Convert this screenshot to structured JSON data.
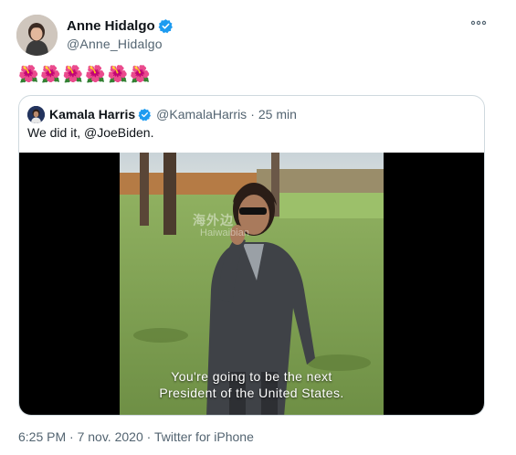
{
  "tweet": {
    "author_name": "Anne Hidalgo",
    "author_handle": "@Anne_Hidalgo",
    "text": "🌺🌺🌺🌺🌺🌺",
    "time": "6:25 PM",
    "date": "7 nov. 2020",
    "separator": "·",
    "source": "Twitter for iPhone",
    "more_icon": "more-horizontal-icon",
    "verified_icon": "verified-badge-icon"
  },
  "quoted": {
    "author_name": "Kamala Harris",
    "author_handle": "@KamalaHarris",
    "separator": "·",
    "time_ago": "25 min",
    "text": "We did it, @JoeBiden.",
    "video": {
      "caption_line1": "You're going to be the next",
      "caption_line2": "President of the United States.",
      "watermark_cn": "海外边",
      "watermark_en": "Haiwaibian"
    }
  },
  "colors": {
    "verified_blue": "#1d9bf0",
    "text_primary": "#0f1419",
    "text_secondary": "#536471",
    "border": "#cfd9de"
  }
}
